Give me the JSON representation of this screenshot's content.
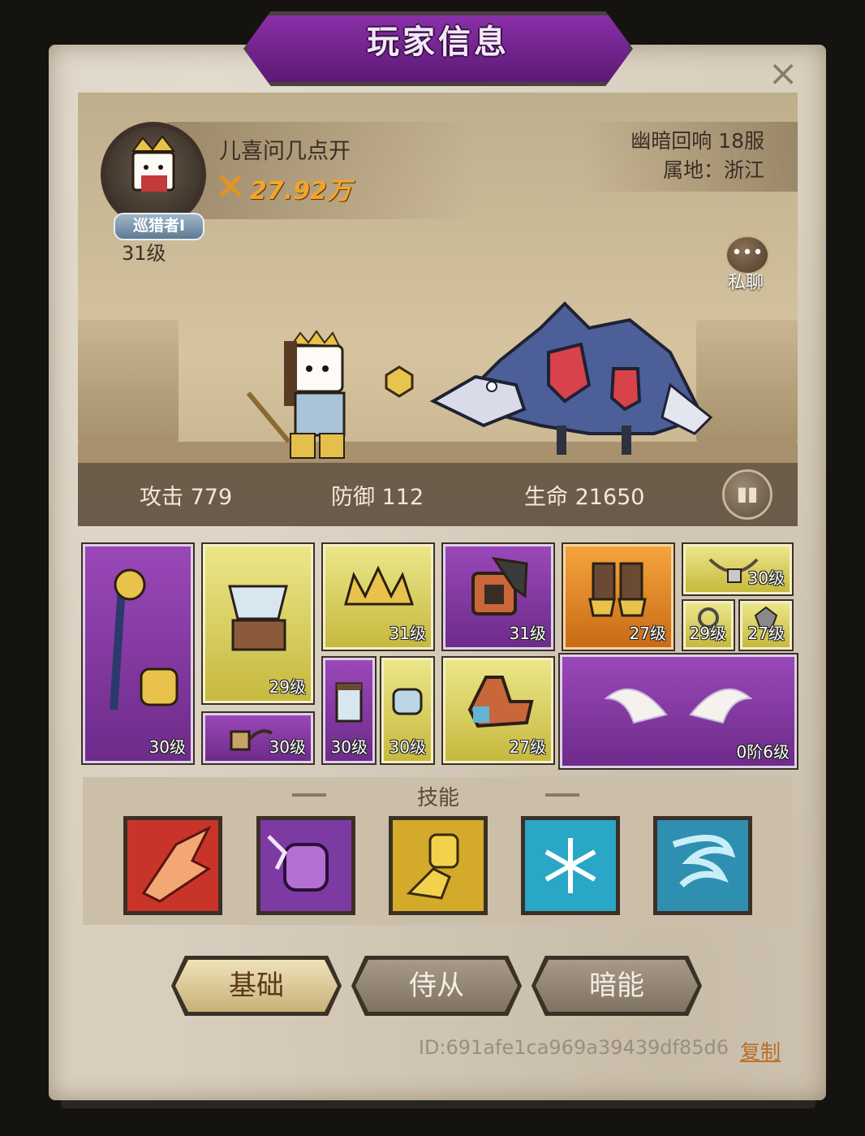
{
  "title": "玩家信息",
  "close_icon": "×",
  "player": {
    "name": "儿喜问几点开",
    "power": "27.92万",
    "rank_badge": "巡猎者Ⅰ",
    "level": "31级",
    "server": "幽暗回响 18服",
    "region": "属地：浙江"
  },
  "chat_button": {
    "label": "私聊",
    "icon": "chat-bubble-icon"
  },
  "stats": {
    "attack": "攻击 779",
    "defense": "防御 112",
    "hp": "生命 21650"
  },
  "equipment": [
    {
      "slot": "weapon",
      "rarity": "purple",
      "level": "30级",
      "icon": "staff-icon"
    },
    {
      "slot": "armor",
      "rarity": "yellow",
      "level": "29级",
      "icon": "chest-armor-icon"
    },
    {
      "slot": "helmet",
      "rarity": "yellow",
      "level": "31级",
      "icon": "crown-icon"
    },
    {
      "slot": "gloves",
      "rarity": "purple",
      "level": "31级",
      "icon": "bracer-icon"
    },
    {
      "slot": "boots",
      "rarity": "orange",
      "level": "27级",
      "icon": "boots-icon"
    },
    {
      "slot": "necklace",
      "rarity": "yellow",
      "level": "30级",
      "icon": "necklace-icon"
    },
    {
      "slot": "ring-1",
      "rarity": "yellow",
      "level": "29级",
      "icon": "ring-icon"
    },
    {
      "slot": "ring-2",
      "rarity": "yellow",
      "level": "27级",
      "icon": "gem-icon"
    },
    {
      "slot": "amulet",
      "rarity": "purple",
      "level": "30级",
      "icon": "chain-amulet-icon"
    },
    {
      "slot": "pants",
      "rarity": "purple",
      "level": "30级",
      "icon": "pants-icon"
    },
    {
      "slot": "wrist",
      "rarity": "yellow",
      "level": "30级",
      "icon": "wristband-icon"
    },
    {
      "slot": "belt",
      "rarity": "yellow",
      "level": "27级",
      "icon": "shoulder-icon"
    },
    {
      "slot": "wings",
      "rarity": "purple",
      "level": "0阶6级",
      "icon": "wings-icon"
    }
  ],
  "skills_title": "技能",
  "skills": [
    {
      "icon": "flame-slash-icon",
      "color": "#c8342a"
    },
    {
      "icon": "purple-fist-icon",
      "color": "#7d3aa3"
    },
    {
      "icon": "dash-icon",
      "color": "#d3aa2a"
    },
    {
      "icon": "snowflake-icon",
      "color": "#2aa6c6"
    },
    {
      "icon": "whirlwind-icon",
      "color": "#2f8fb0"
    }
  ],
  "tabs": [
    {
      "label": "基础",
      "active": true
    },
    {
      "label": "侍从",
      "active": false
    },
    {
      "label": "暗能",
      "active": false
    }
  ],
  "player_id": "ID:691afe1ca969a39439df85d6",
  "copy_label": "复制"
}
